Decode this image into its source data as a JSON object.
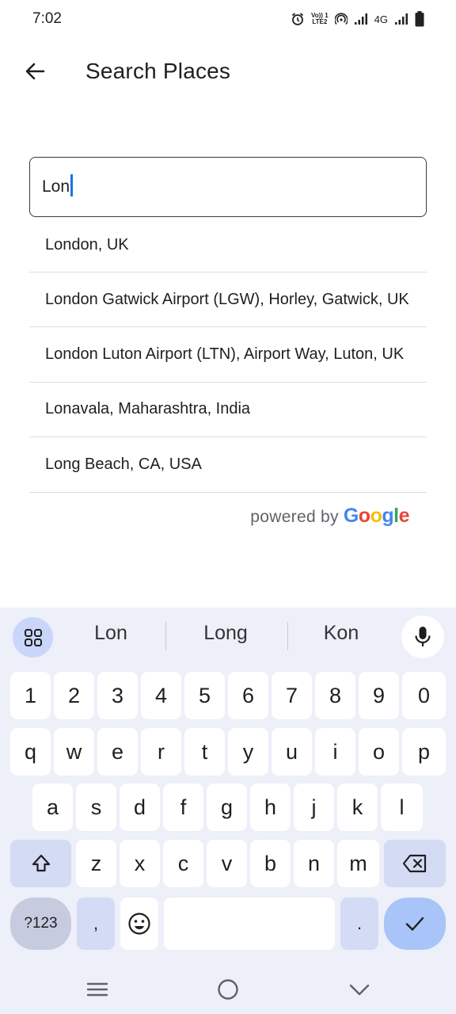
{
  "status_bar": {
    "time": "7:02",
    "volte_top": "Vo)) 1",
    "volte_bottom": "LTE2",
    "network_type": "4G"
  },
  "header": {
    "title": "Search Places",
    "back_icon": "arrow-left-icon"
  },
  "search": {
    "value": "Lon"
  },
  "results": [
    "London, UK",
    "London Gatwick Airport (LGW), Horley, Gatwick, UK",
    "London Luton Airport (LTN), Airport Way, Luton, UK",
    "Lonavala, Maharashtra, India",
    "Long Beach, CA, USA"
  ],
  "attribution": {
    "prefix": "powered by",
    "brand": [
      "G",
      "o",
      "o",
      "g",
      "l",
      "e"
    ]
  },
  "keyboard": {
    "suggestions": [
      "Lon",
      "Long",
      "Kon"
    ],
    "row_numbers": [
      "1",
      "2",
      "3",
      "4",
      "5",
      "6",
      "7",
      "8",
      "9",
      "0"
    ],
    "row_1": [
      "q",
      "w",
      "e",
      "r",
      "t",
      "y",
      "u",
      "i",
      "o",
      "p"
    ],
    "row_2": [
      "a",
      "s",
      "d",
      "f",
      "g",
      "h",
      "j",
      "k",
      "l"
    ],
    "row_3": [
      "z",
      "x",
      "c",
      "v",
      "b",
      "n",
      "m"
    ],
    "symbols_label": "?123",
    "comma": ",",
    "period": ".",
    "colors": {
      "background": "#edeff9",
      "enter": "#a8c4f8",
      "special": "#d4dbf4"
    }
  },
  "nav": {
    "icons": [
      "menu-icon",
      "home-icon",
      "back-chevron-icon"
    ]
  }
}
